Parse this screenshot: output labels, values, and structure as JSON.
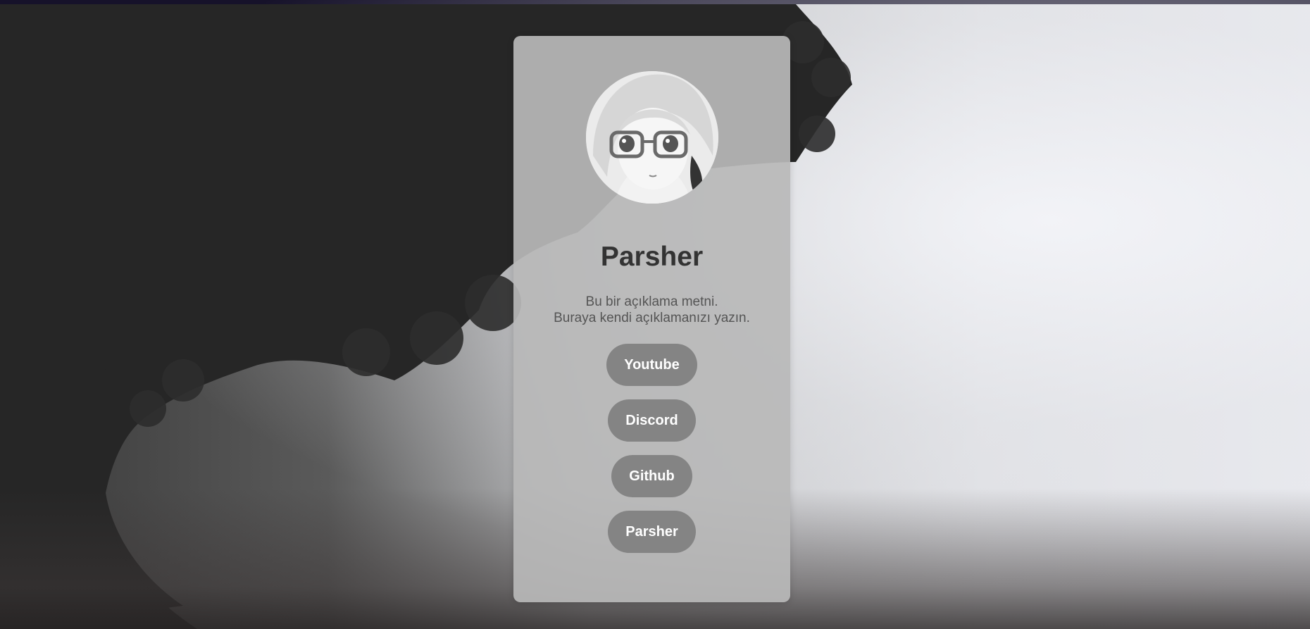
{
  "profile": {
    "name": "Parsher",
    "description_line1": "Bu bir açıklama metni.",
    "description_line2": "Buraya kendi açıklamanızı yazın.",
    "avatar_icon": "anime-girl-with-glasses-avatar"
  },
  "links": [
    {
      "label": "Youtube"
    },
    {
      "label": "Discord"
    },
    {
      "label": "Github"
    },
    {
      "label": "Parsher"
    }
  ],
  "colors": {
    "top_bar": "#16122a",
    "card_background": "#b9b9b9",
    "button_background": "#848484",
    "button_text": "#ffffff",
    "name_text": "#333333",
    "description_text": "#555555"
  }
}
